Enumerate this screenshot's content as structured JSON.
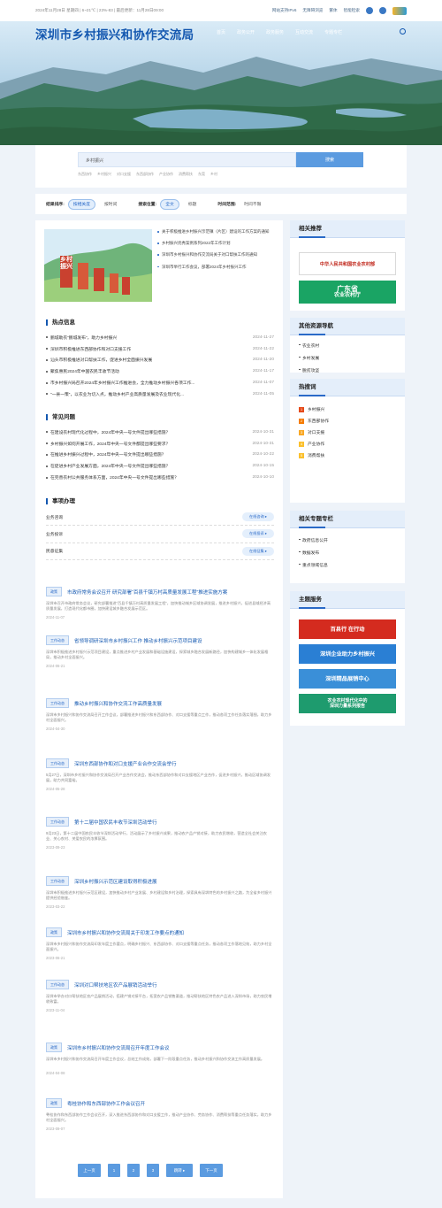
{
  "topbar": {
    "date": "2024年11月28日 星期四 | 6~21℃ | 23%-83 | 最后更新：11月28日09:00",
    "links": [
      "网站支持IPv6",
      "无障碍浏览",
      "繁体"
    ],
    "smart_label": "智能检索"
  },
  "header": {
    "title": "深圳市乡村振兴和协作交流局",
    "nav": [
      "首页",
      "政务公开",
      "政务服务",
      "互动交流",
      "专题专栏"
    ]
  },
  "search": {
    "value": "乡村振兴",
    "button": "搜索",
    "hotwords": [
      "东西协作",
      "乡村振兴",
      "对口支援",
      "东西部协作",
      "产业协作",
      "消费帮扶",
      "东莞",
      "乡村"
    ]
  },
  "filter": {
    "sort_label": "结果排序:",
    "sort_options": [
      "按相关度",
      "按时间"
    ],
    "pos_label": "搜索位置:",
    "pos_options": [
      "全文",
      "标题"
    ],
    "time_label": "时间范围:",
    "time_value": "时间不限"
  },
  "featured": {
    "image_text": "乡村振兴",
    "items": [
      "关于积极推进乡村振兴示范镇（片区）建设的工作方案的通知",
      "乡村振兴优秀案例系列2022年工作计划",
      "深圳市乡村振兴和协作交流局关于对口帮扶工作的通知",
      "深圳市举行工作会议，部署2024年乡村振兴工作"
    ]
  },
  "hot_info": {
    "title": "热点信息",
    "items": [
      {
        "title": "鹏城助农“鹏城发布”，助力乡村振兴",
        "date": "2024-11-27"
      },
      {
        "title": "深圳市积极推进东西部协作和对口支援工作",
        "date": "2024-11-22"
      },
      {
        "title": "汕头市积极推进对口帮扶工作，促进乡村全面振兴发展",
        "date": "2024-11-20"
      },
      {
        "title": "聚焦惠民2024年中国农民丰收节活动",
        "date": "2024-11-17"
      },
      {
        "title": "市乡村振兴局召开2024年乡村振兴工作推进会，全力推动乡村振兴各项工作...",
        "date": "2024-11-07"
      },
      {
        "title": "“一县一策”，以农业为切入点，推动乡村产业高质量发展及农业现代化...",
        "date": "2024-11-05"
      }
    ]
  },
  "faq": {
    "title": "常见问题",
    "items": [
      {
        "title": "在建设农村现代化过程中，2024年中央一号文件提出哪些措施？",
        "date": "2024-10-31"
      },
      {
        "title": "乡村振兴如何开展工作，2024年中央一号文件都提出哪些要求？",
        "date": "2024-10-31"
      },
      {
        "title": "在推进乡村振兴过程中，2024年中央一号文件提出哪些措施？",
        "date": "2024-10-22"
      },
      {
        "title": "在促进乡村产业发展方面，2024年中央一号文件提出哪些措施？",
        "date": "2024-10-15"
      },
      {
        "title": "在完善农村公共服务体系方面，2024年中央一号文件提出哪些措施？",
        "date": "2024-10-10"
      }
    ]
  },
  "services": {
    "title": "事项办理",
    "items": [
      {
        "title": "业务咨询",
        "btn": "在线咨询 ▸"
      },
      {
        "title": "业务投诉",
        "btn": "在线投诉 ▸"
      },
      {
        "title": "民意征集",
        "btn": "在线征集 ▸"
      }
    ]
  },
  "articles": [
    {
      "tag": "政策",
      "title": "市政府常务会议召开 研究部署“百县千镇万村高质量发展工程”推进实施方案",
      "summary": "深圳市召开市政府常务会议，研究部署推进“百县千镇万村高质量发展工程”，加快推动城乡区域协调发展，推进乡村振兴，促进县域经济高质量发展，打造现代化都市圈，加快建设城乡融合发展示范区。",
      "date": "2024-11-07"
    },
    {
      "tag": "工作动态",
      "title": "省领导调研深圳市乡村振兴工作 推动乡村振兴示范项目建设",
      "summary": "深圳市积极推进乡村振兴示范项目建设，重点推进乡村产业发展和基础设施建设，探索城乡融合发展新路径，加快构建城乡一体化发展格局，推动乡村全面振兴。",
      "date": "2024-06-21"
    },
    {
      "tag": "工作动态",
      "title": "推动乡村振兴和协作交流工作高质量发展",
      "summary": "深圳市乡村振兴和协作交流局召开工作会议，部署推进乡村振兴和东西部协作、对口支援等重点工作，推动各项工作任务落实落细，助力乡村全面振兴。",
      "date": "2024-04-30"
    },
    {
      "tag": "工作动态",
      "title": "深圳东西部协作和对口支援产业合作交流会举行",
      "summary": "5月27日，深圳市乡村振兴和协作交流局召开产业合作交流会，推动东西部协作和对口支援地区产业合作，促进乡村振兴，推动区域协调发展，助力共同富裕。",
      "date": "2024-05-28"
    },
    {
      "tag": "工作动态",
      "title": "第十二届中国农民丰收节深圳活动举行",
      "summary": "9月23日，第十二届中国农民丰收节深圳活动举行，活动展示了乡村振兴成果，推动农产品产销对接，助力农民增收，营造全社会关注农业、关心农村、关爱农民的浓厚氛围。",
      "date": "2023-09-23"
    },
    {
      "tag": "工作动态",
      "title": "深圳乡村振兴示范区建设取得积极进展",
      "summary": "深圳市积极推进乡村振兴示范区建设，加快推动乡村产业发展、乡村建设和乡村治理，探索具有深圳特色的乡村振兴之路，为全省乡村振兴提供经验借鉴。",
      "date": "2023-03-22"
    },
    {
      "tag": "政策",
      "title": "深圳市乡村振兴和协作交流局关于印发工作要点的通知",
      "summary": "深圳市乡村振兴和协作交流局印发年度工作要点，明确乡村振兴、东西部协作、对口支援等重点任务，推动各项工作落地见效，助力乡村全面振兴。",
      "date": "2023-06-21"
    },
    {
      "tag": "工作动态",
      "title": "深圳对口帮扶地区农产品展销活动举行",
      "summary": "深圳市举办对口帮扶地区农产品展销活动，搭建产销对接平台，拓宽农产品销售渠道，推动帮扶地区特色农产品进入深圳市场，助力农民增收致富。",
      "date": "2023-11-04"
    },
    {
      "tag": "政策",
      "title": "深圳市乡村振兴和协作交流局召开年度工作会议",
      "summary": "深圳市乡村振兴和协作交流局召开年度工作会议，总结工作成效，部署下一阶段重点任务，推动乡村振兴和协作交流工作高质量发展。",
      "date": "2024-04-08"
    },
    {
      "tag": "政策",
      "title": "粤桂协作和东西部协作工作会议召开",
      "summary": "粤桂协作和东西部协作工作会议召开，深入推进东西部协作和对口支援工作，推动产业协作、劳务协作、消费帮扶等重点任务落实，助力乡村全面振兴。",
      "date": "2023-09-07"
    }
  ],
  "pager": [
    "上一页",
    "1",
    "2",
    "3",
    "跳转 ▸",
    "下一页"
  ],
  "side": {
    "related_title": "相关推荐",
    "banner1": "中华人民共和国农业农村部",
    "banner2_top": "广东省",
    "banner2_bottom": "农业农村厅",
    "resources_title": "其他资源导航",
    "resources": [
      "农业农村",
      "乡村发展",
      "脱贫攻坚"
    ],
    "hot_title": "热搜词",
    "hot": [
      "乡村振兴",
      "东西部协作",
      "对口支援",
      "产业协作",
      "消费帮扶"
    ],
    "topics_title": "相关专题专栏",
    "topics": [
      "政府信息公开",
      "数据发布",
      "重点领域信息"
    ],
    "theme_title": "主题服务",
    "theme1": "百县行 在行动",
    "theme2": "深圳企业助力乡村振兴",
    "theme3": "深圳精品展销中心",
    "theme4_top": "农业农村现代化中的",
    "theme4_bottom": "深圳力量系列报告"
  },
  "colors": {
    "brand": "#1458b0",
    "accent": "#5b9be0",
    "theme_red": "#d42b1f",
    "theme_green": "#1e9b6e"
  }
}
